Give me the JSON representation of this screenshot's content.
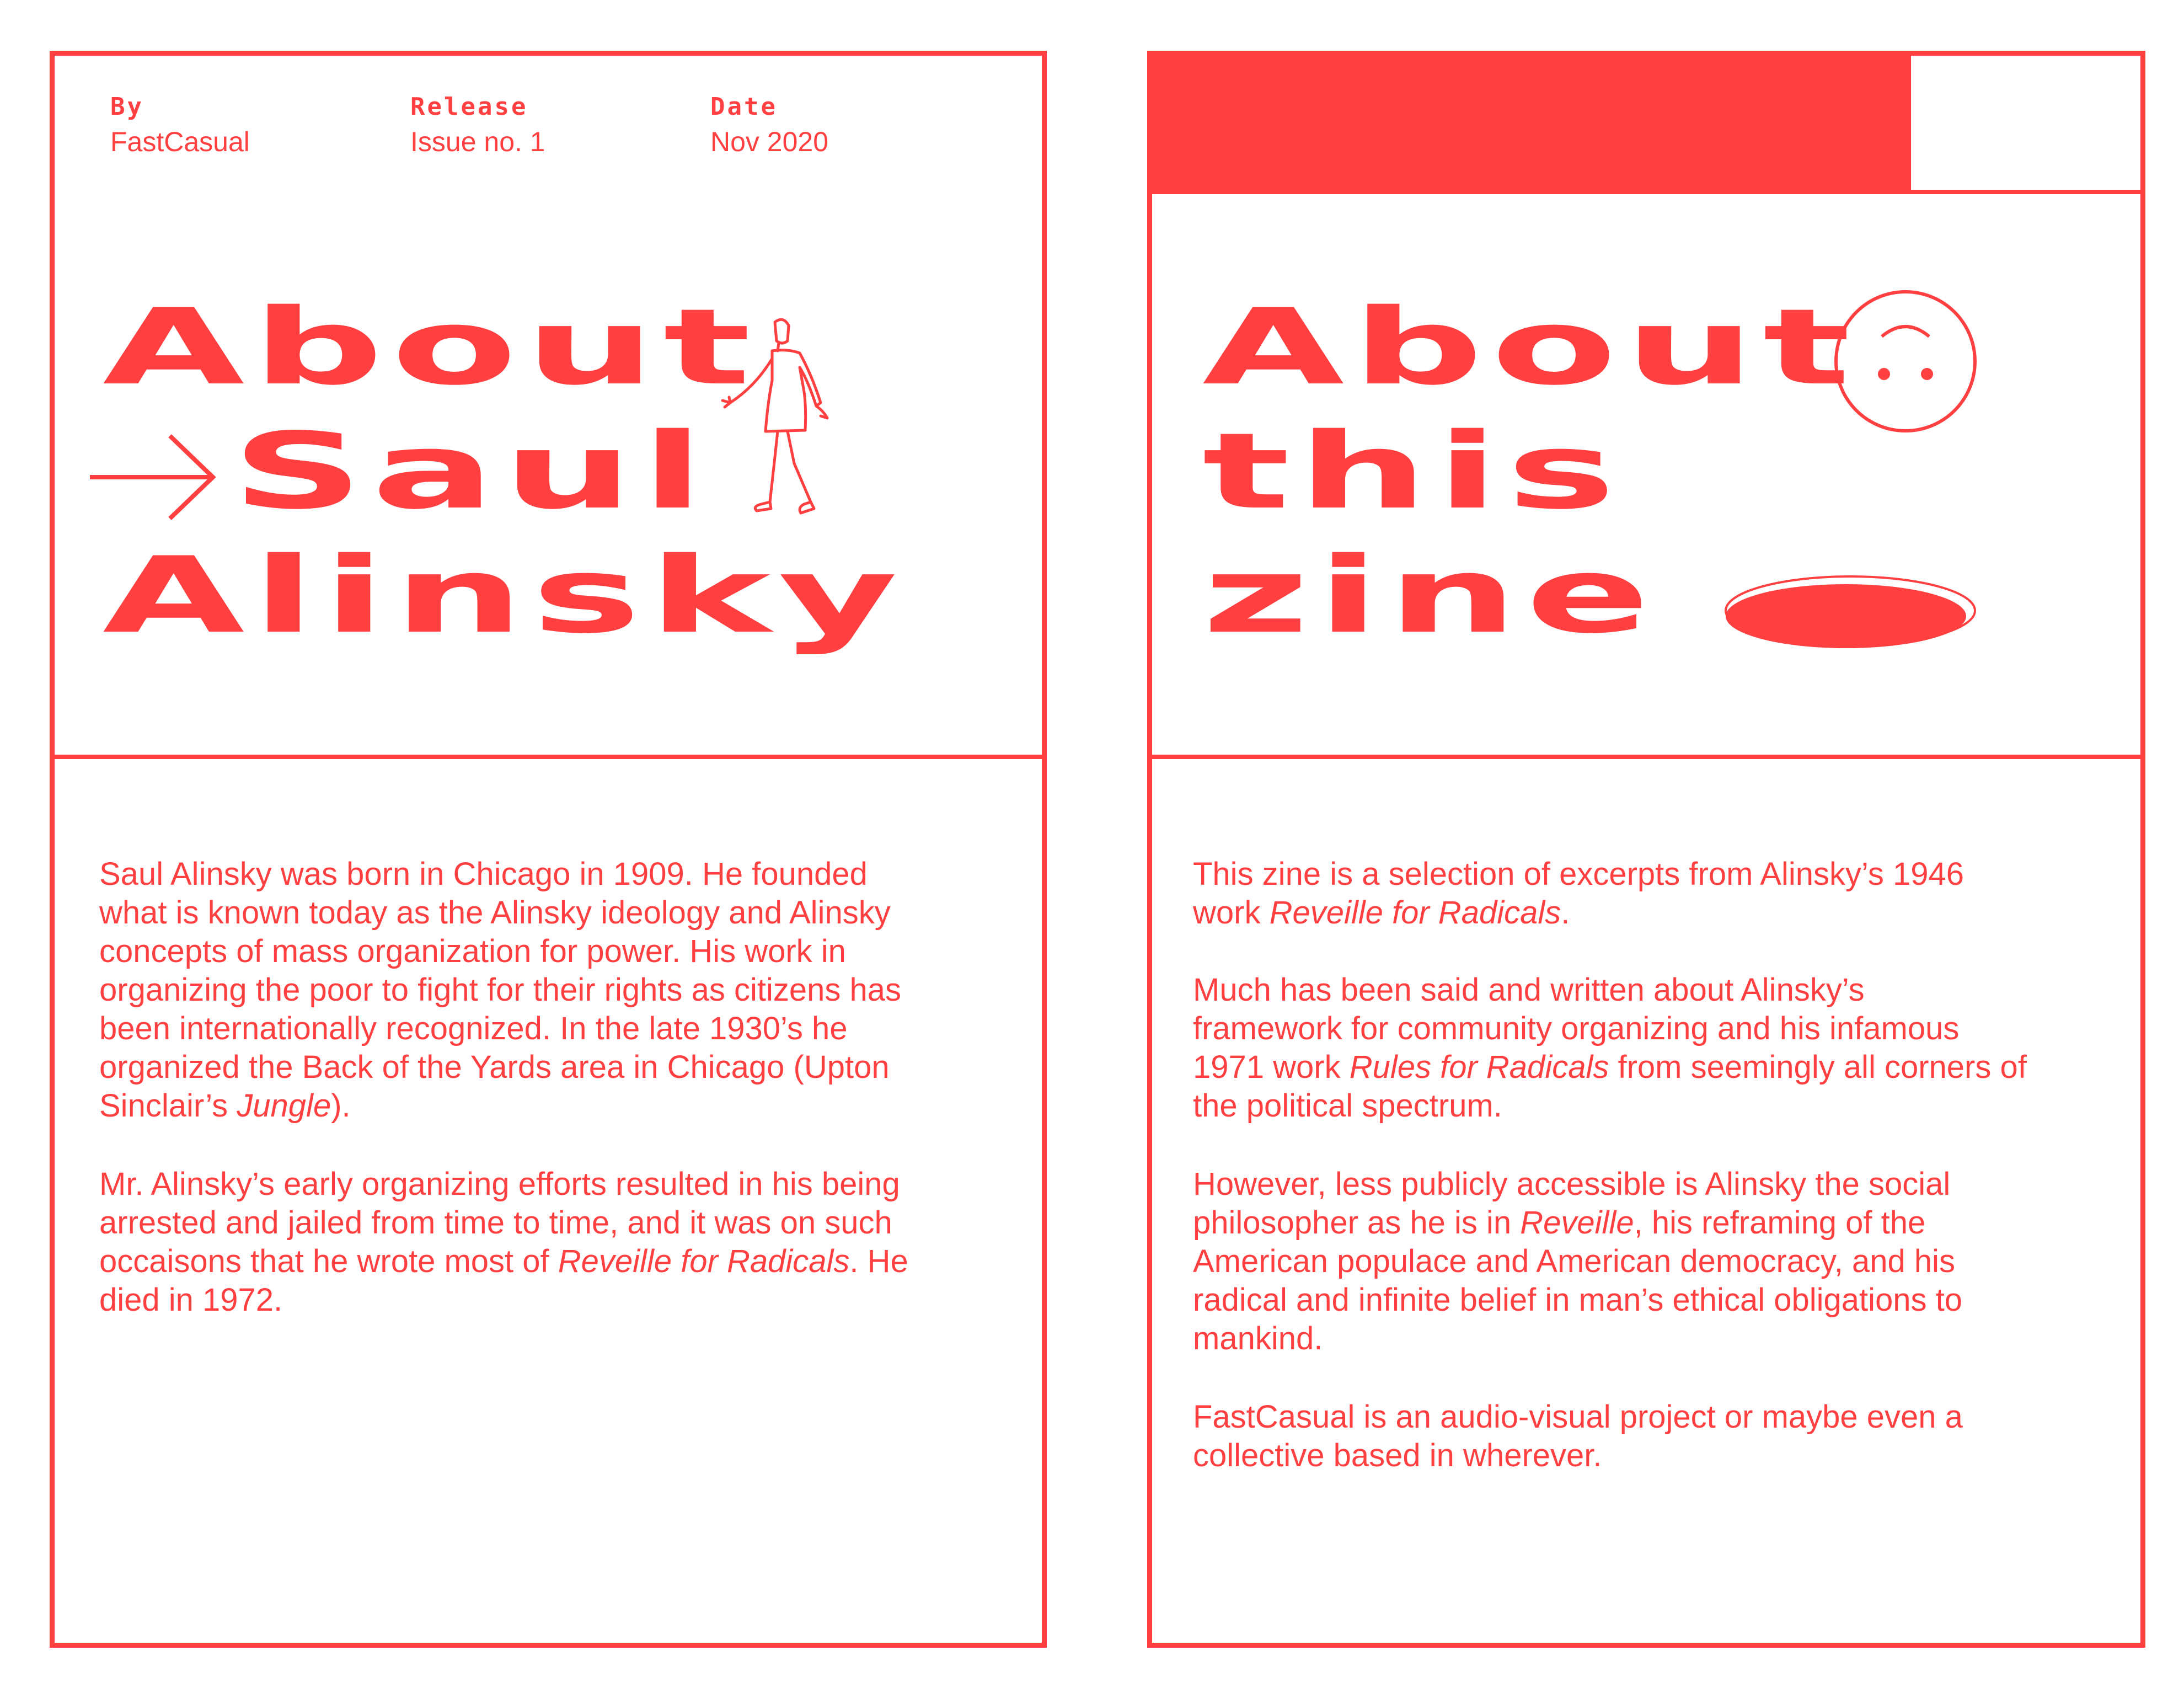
{
  "left": {
    "meta": [
      {
        "label": "By",
        "value": "FastCasual"
      },
      {
        "label": "Release",
        "value": "Issue no. 1"
      },
      {
        "label": "Date",
        "value": "Nov 2020"
      }
    ],
    "title_lines": [
      "About",
      "Saul",
      "Alinsky"
    ],
    "paragraph1": {
      "lines": [
        "Saul Alinsky was born in Chicago in 1909. He founded",
        "what is known today as the Alinsky ideology and Alinsky",
        "concepts of mass organization for power. His work in",
        "organizing the poor to fight for their rights as citizens has",
        "been internationally recognized. In the late 1930’s he",
        "organized the Back of the Yards area in Chicago (Upton"
      ],
      "last_pre": "Sinclair’s ",
      "last_em": "Jungle",
      "last_post": ")."
    },
    "paragraph2": {
      "line1": "Mr. Alinsky’s early organizing efforts resulted in his being",
      "line2": "arrested and jailed from time to time, and it was on such",
      "line3_pre": "occaisons that he wrote most of ",
      "line3_em": "Reveille for Radicals",
      "line3_post": ". He",
      "line4": "died in 1972."
    }
  },
  "right": {
    "title_lines": [
      "About",
      "this",
      "zine"
    ],
    "paragraph1": {
      "line1": "This zine is a selection of excerpts from Alinsky’s 1946",
      "line2_pre": "work ",
      "line2_em": "Reveille for Radicals",
      "line2_post": "."
    },
    "paragraph2": {
      "line1": "Much has been said and written about Alinsky’s",
      "line2": "framework for community organizing and his infamous",
      "line3_pre": "1971 work ",
      "line3_em": "Rules for Radicals",
      "line3_post": " from seemingly all corners of",
      "line4": "the political spectrum."
    },
    "paragraph3": {
      "line1": "However, less publicly accessible is Alinsky the social",
      "line2_pre": "philosopher as he is in ",
      "line2_em": "Reveille",
      "line2_post": ", his reframing of the",
      "line3": "American populace and American democracy, and his",
      "line4": "radical and infinite belief in man’s ethical obligations to",
      "line5": "mankind."
    },
    "paragraph4": {
      "line1": "FastCasual is an audio-visual project or maybe even a",
      "line2": "collective based in wherever."
    }
  },
  "colors": {
    "accent": "#ff3f40",
    "background": "#ffffff"
  },
  "icons": [
    "arrow-right-icon",
    "walking-man-icon",
    "smiley-face-icon",
    "hole-icon"
  ]
}
